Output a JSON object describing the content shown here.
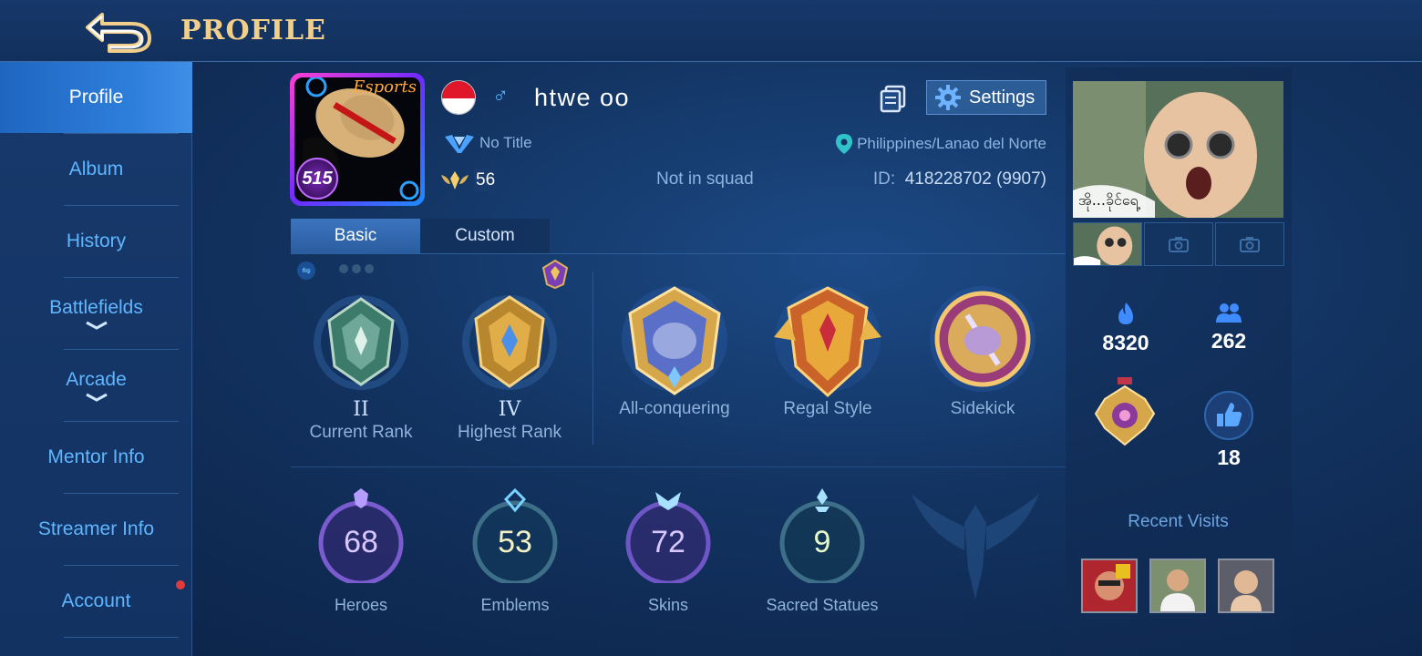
{
  "header": {
    "title": "PROFILE",
    "back_icon": "back-arrow-icon"
  },
  "sidebar": {
    "items": [
      {
        "label": "Profile",
        "active": true
      },
      {
        "label": "Album"
      },
      {
        "label": "History"
      },
      {
        "label": "Battlefields",
        "expandable": true
      },
      {
        "label": "Arcade",
        "expandable": true
      },
      {
        "label": "Mentor Info"
      },
      {
        "label": "Streamer Info"
      },
      {
        "label": "Account",
        "notification": true
      }
    ]
  },
  "player": {
    "avatar_tag": "Esports",
    "avatar_level_badge": "515",
    "flag": "Indonesia",
    "gender_symbol": "♂",
    "name": "htwe oo",
    "title": "No Title",
    "level": "56",
    "squad": "Not in squad",
    "location": "Philippines/Lanao del Norte",
    "id_label": "ID:",
    "id_value": "418228702 (9907)"
  },
  "actions": {
    "settings_label": "Settings"
  },
  "tabs": [
    {
      "label": "Basic",
      "active": true
    },
    {
      "label": "Custom",
      "active": false
    }
  ],
  "medals": [
    {
      "roman": "II",
      "label": "Current Rank"
    },
    {
      "roman": "IV",
      "label": "Highest Rank"
    },
    {
      "roman": "",
      "label": "All-conquering"
    },
    {
      "roman": "",
      "label": "Regal Style"
    },
    {
      "roman": "",
      "label": "Sidekick"
    }
  ],
  "stats": [
    {
      "value": "68",
      "label": "Heroes",
      "color": "#d8c8ff"
    },
    {
      "value": "53",
      "label": "Emblems",
      "color": "#f3f1c2"
    },
    {
      "value": "72",
      "label": "Skins",
      "color": "#d8c8ff"
    },
    {
      "value": "9",
      "label": "Sacred Statues",
      "color": "#e6f7c9"
    }
  ],
  "right_panel": {
    "photo_caption": "အို...ခိုင်ရေ့",
    "popularity": "8320",
    "followers": "262",
    "likes": "18",
    "recent_visits_title": "Recent Visits"
  },
  "colors": {
    "accent_gold": "#f1cf8a",
    "sidebar_text": "#5fb6ff",
    "active_tab": "#2e7fdc",
    "notification_red": "#e23b3b"
  }
}
